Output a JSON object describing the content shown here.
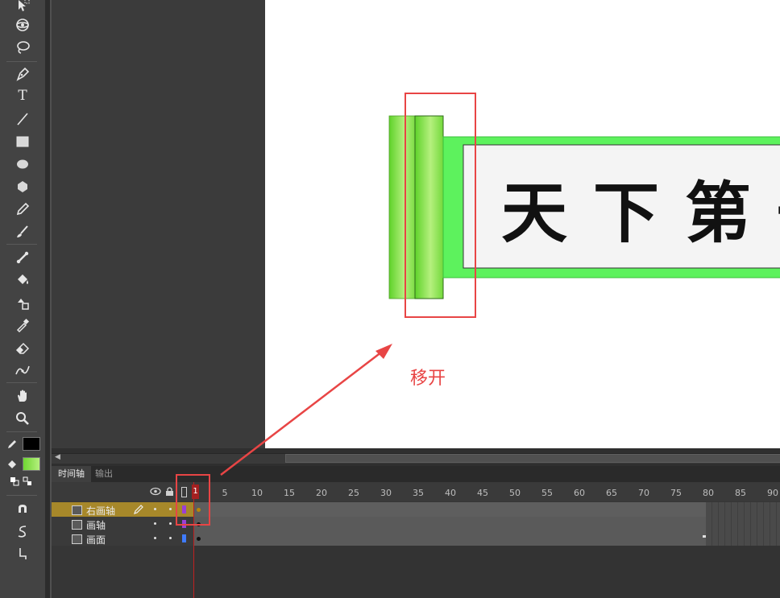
{
  "tools": {
    "items": [
      {
        "name": "subselection-tool",
        "icon": "subselection-icon"
      },
      {
        "name": "3d-rotation-tool",
        "icon": "3d-rotation-icon"
      },
      {
        "name": "lasso-tool",
        "icon": "lasso-icon"
      },
      {
        "name": "pen-tool",
        "icon": "pen-icon"
      },
      {
        "name": "text-tool",
        "icon": "text-icon",
        "glyph": "T"
      },
      {
        "name": "line-tool",
        "icon": "line-icon"
      },
      {
        "name": "rectangle-tool",
        "icon": "rectangle-icon"
      },
      {
        "name": "oval-tool",
        "icon": "oval-icon"
      },
      {
        "name": "polystar-tool",
        "icon": "polystar-icon"
      },
      {
        "name": "pencil-tool",
        "icon": "pencil-icon"
      },
      {
        "name": "brush-tool",
        "icon": "brush-icon"
      },
      {
        "name": "bone-tool",
        "icon": "bone-icon"
      },
      {
        "name": "paint-bucket-tool",
        "icon": "paint-bucket-icon"
      },
      {
        "name": "ink-bottle-tool",
        "icon": "ink-bottle-icon"
      },
      {
        "name": "eyedropper-tool",
        "icon": "eyedropper-icon"
      },
      {
        "name": "eraser-tool",
        "icon": "eraser-icon"
      },
      {
        "name": "width-tool",
        "icon": "width-icon"
      },
      {
        "name": "hand-tool",
        "icon": "hand-icon"
      },
      {
        "name": "zoom-tool",
        "icon": "zoom-icon"
      }
    ],
    "stroke_color": "#000000",
    "fill_color": "#8ee04a",
    "bottom_icons": [
      "snap-magnet-icon",
      "smooth-icon",
      "straighten-icon"
    ]
  },
  "stage": {
    "scroll_text": "天下第一",
    "annotation_label": "移开",
    "annotation_color": "#e84545",
    "scroll_green": "#5df25d",
    "rod_green": "#8ee04a"
  },
  "timeline": {
    "tabs": [
      {
        "label": "时间轴"
      },
      {
        "label": "输出"
      }
    ],
    "ruler": [
      "1",
      "5",
      "10",
      "15",
      "20",
      "25",
      "30",
      "35",
      "40",
      "45",
      "50",
      "55",
      "60",
      "65",
      "70",
      "75",
      "80",
      "85",
      "90"
    ],
    "layers": [
      {
        "name": "右画轴",
        "selected": true,
        "color": "#9b3fd6"
      },
      {
        "name": "画轴",
        "selected": false,
        "color": "#9b3fd6"
      },
      {
        "name": "画面",
        "selected": false,
        "color": "#3f7bff"
      }
    ],
    "header_icons": [
      "eye-icon",
      "lock-icon",
      "outline-icon"
    ]
  }
}
